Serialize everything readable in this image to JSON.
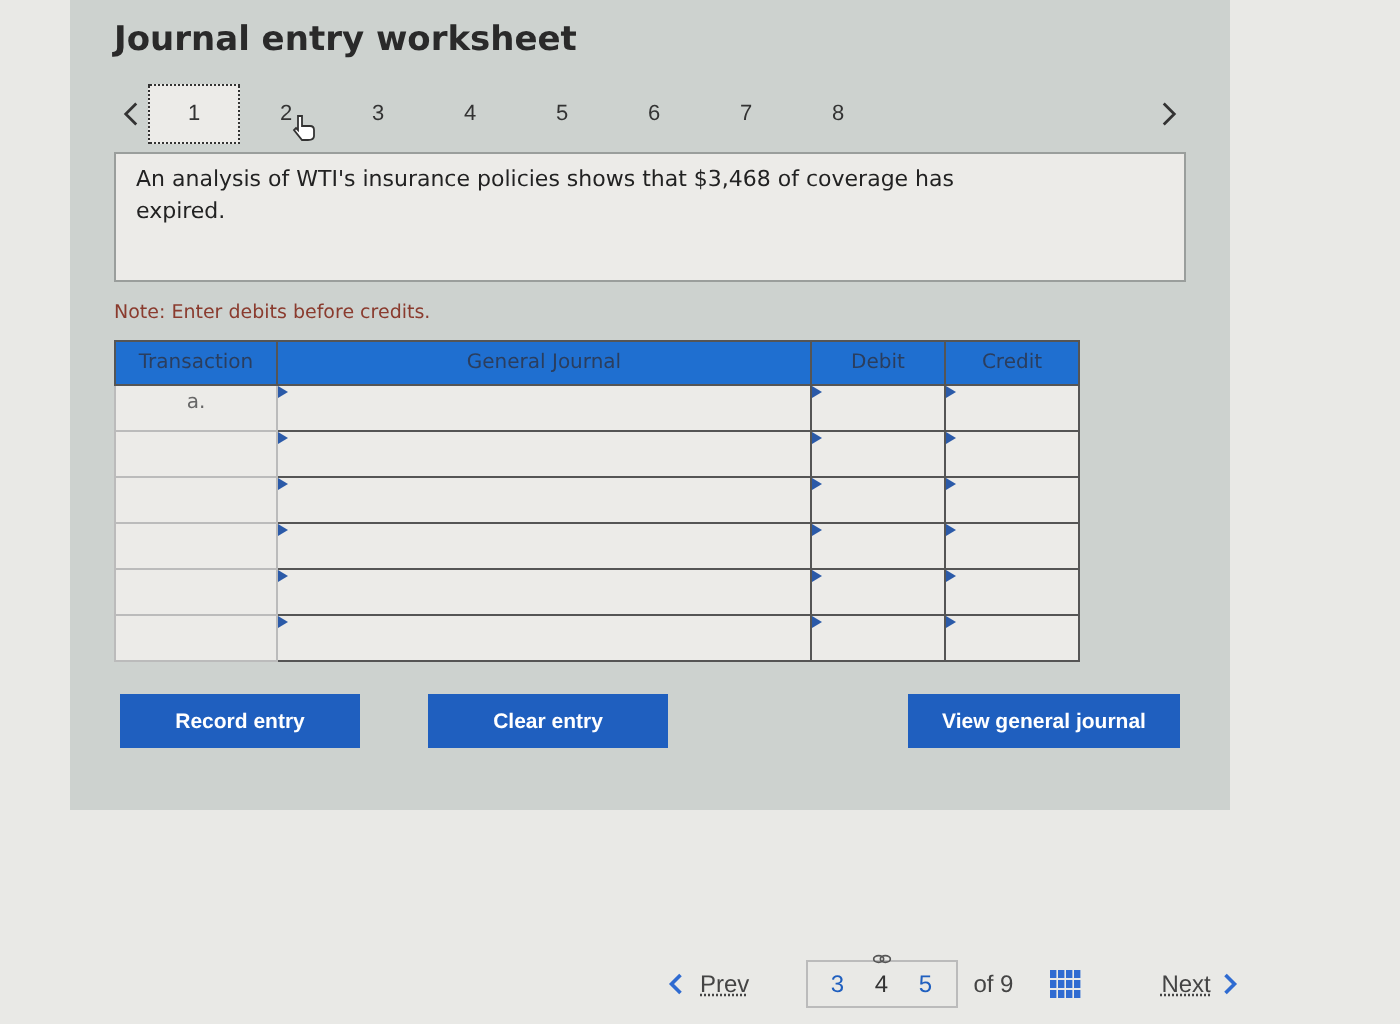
{
  "title": "Journal entry worksheet",
  "tabs": [
    {
      "label": "1",
      "selected": true
    },
    {
      "label": "2",
      "selected": false
    },
    {
      "label": "3",
      "selected": false
    },
    {
      "label": "4",
      "selected": false
    },
    {
      "label": "5",
      "selected": false
    },
    {
      "label": "6",
      "selected": false
    },
    {
      "label": "7",
      "selected": false
    },
    {
      "label": "8",
      "selected": false
    }
  ],
  "question": "An analysis of WTI's insurance policies shows that $3,468 of coverage has expired.",
  "note": "Note: Enter debits before credits.",
  "table": {
    "columns": [
      "Transaction",
      "General Journal",
      "Debit",
      "Credit"
    ],
    "rows": [
      {
        "transaction": "a."
      },
      {},
      {},
      {},
      {},
      {}
    ]
  },
  "buttons": [
    "Record entry",
    "Clear entry",
    "View general journal"
  ],
  "footer": {
    "prev": "Prev",
    "pages": [
      {
        "label": "3",
        "selected": false
      },
      {
        "label": "4",
        "selected": true
      },
      {
        "label": "5",
        "selected": false
      }
    ],
    "of": "of 9",
    "next": "Next"
  }
}
